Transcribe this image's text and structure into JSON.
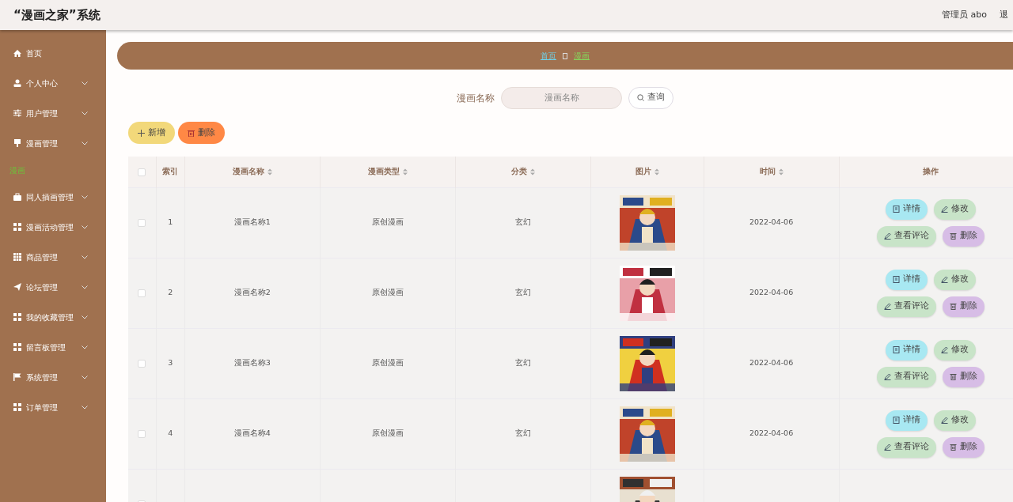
{
  "header": {
    "title": "“漫画之家”系统",
    "user": "管理员 abo",
    "logout": "退"
  },
  "sidebar": {
    "items": [
      {
        "label": "首页",
        "kind": "home"
      },
      {
        "label": "个人中心",
        "kind": "group"
      },
      {
        "label": "用户管理",
        "kind": "group"
      },
      {
        "label": "漫画管理",
        "kind": "group",
        "children": [
          {
            "label": "漫画",
            "selected": true
          }
        ]
      },
      {
        "label": "同人插画管理",
        "kind": "group"
      },
      {
        "label": "漫画活动管理",
        "kind": "group"
      },
      {
        "label": "商品管理",
        "kind": "group"
      },
      {
        "label": "论坛管理",
        "kind": "group"
      },
      {
        "label": "我的收藏管理",
        "kind": "group"
      },
      {
        "label": "留言板管理",
        "kind": "group"
      },
      {
        "label": "系统管理",
        "kind": "group"
      },
      {
        "label": "订单管理",
        "kind": "group"
      }
    ]
  },
  "breadcrumb": [
    {
      "label": "首页",
      "selected": false
    },
    {
      "label": "漫画",
      "selected": true
    }
  ],
  "search": {
    "label": "漫画名称",
    "placeholder": "漫画名称",
    "button": "查询"
  },
  "toolbar": [
    {
      "label": "新增",
      "kind": "add"
    },
    {
      "label": "删除",
      "kind": "delete"
    }
  ],
  "table": {
    "header_checked": false,
    "columns": [
      {
        "kind": "check"
      },
      {
        "label": "索引",
        "kind": "text",
        "sortable": false
      },
      {
        "label": "漫画名称",
        "kind": "text",
        "sortable": true
      },
      {
        "label": "漫画类型",
        "kind": "text",
        "sortable": true
      },
      {
        "label": "分类",
        "kind": "text",
        "sortable": true
      },
      {
        "label": "图片",
        "kind": "text",
        "sortable": true
      },
      {
        "label": "时间",
        "kind": "text",
        "sortable": true
      },
      {
        "label": "操作",
        "kind": "text",
        "sortable": false
      }
    ],
    "rows": [
      {
        "checked": false,
        "index": "1",
        "name": "漫画名称1",
        "type": "原创漫画",
        "category": "玄幻",
        "image": {
          "kind": "picture"
        },
        "time": "2022-04-06",
        "actions": [
          {
            "label": "详情",
            "kind": "detail"
          },
          {
            "label": "修改",
            "kind": "edit"
          },
          {
            "label": "查看评论",
            "kind": "comment"
          },
          {
            "label": "删除",
            "kind": "delete"
          }
        ]
      },
      {
        "checked": false,
        "index": "2",
        "name": "漫画名称2",
        "type": "原创漫画",
        "category": "玄幻",
        "image": {
          "kind": "picture"
        },
        "time": "2022-04-06",
        "actions": [
          {
            "label": "详情",
            "kind": "detail"
          },
          {
            "label": "修改",
            "kind": "edit"
          },
          {
            "label": "查看评论",
            "kind": "comment"
          },
          {
            "label": "删除",
            "kind": "delete"
          }
        ]
      },
      {
        "checked": false,
        "index": "3",
        "name": "漫画名称3",
        "type": "原创漫画",
        "category": "玄幻",
        "image": {
          "kind": "picture"
        },
        "time": "2022-04-06",
        "actions": [
          {
            "label": "详情",
            "kind": "detail"
          },
          {
            "label": "修改",
            "kind": "edit"
          },
          {
            "label": "查看评论",
            "kind": "comment"
          },
          {
            "label": "删除",
            "kind": "delete"
          }
        ]
      },
      {
        "checked": false,
        "index": "4",
        "name": "漫画名称4",
        "type": "原创漫画",
        "category": "玄幻",
        "image": {
          "kind": "picture"
        },
        "time": "2022-04-06",
        "actions": [
          {
            "label": "详情",
            "kind": "detail"
          },
          {
            "label": "修改",
            "kind": "edit"
          },
          {
            "label": "查看评论",
            "kind": "comment"
          },
          {
            "label": "删除",
            "kind": "delete"
          }
        ]
      },
      {
        "checked": false,
        "image": {
          "kind": "picture"
        }
      }
    ]
  }
}
